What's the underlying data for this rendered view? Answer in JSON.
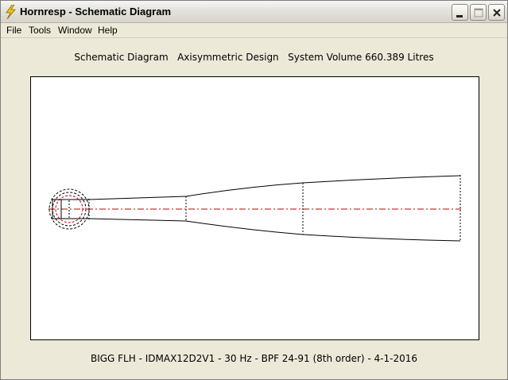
{
  "window": {
    "title": "Hornresp - Schematic Diagram"
  },
  "menu": {
    "items": [
      "File",
      "Tools",
      "Window",
      "Help"
    ]
  },
  "diagram": {
    "header": "Schematic Diagram   Axisymmetric Design   System Volume 660.389 Litres",
    "footer": "BIGG FLH - IDMAX12D2V1 - 30 Hz - BPF 24-91 (8th order) - 4-1-2016"
  },
  "icons": {
    "app": "lightning-bolt-icon",
    "minimize": "minimize-icon",
    "maximize": "maximize-icon",
    "close": "close-icon"
  },
  "colors": {
    "centerline": "#c00000",
    "outline": "#000000",
    "driver_dashed": "#000000"
  }
}
